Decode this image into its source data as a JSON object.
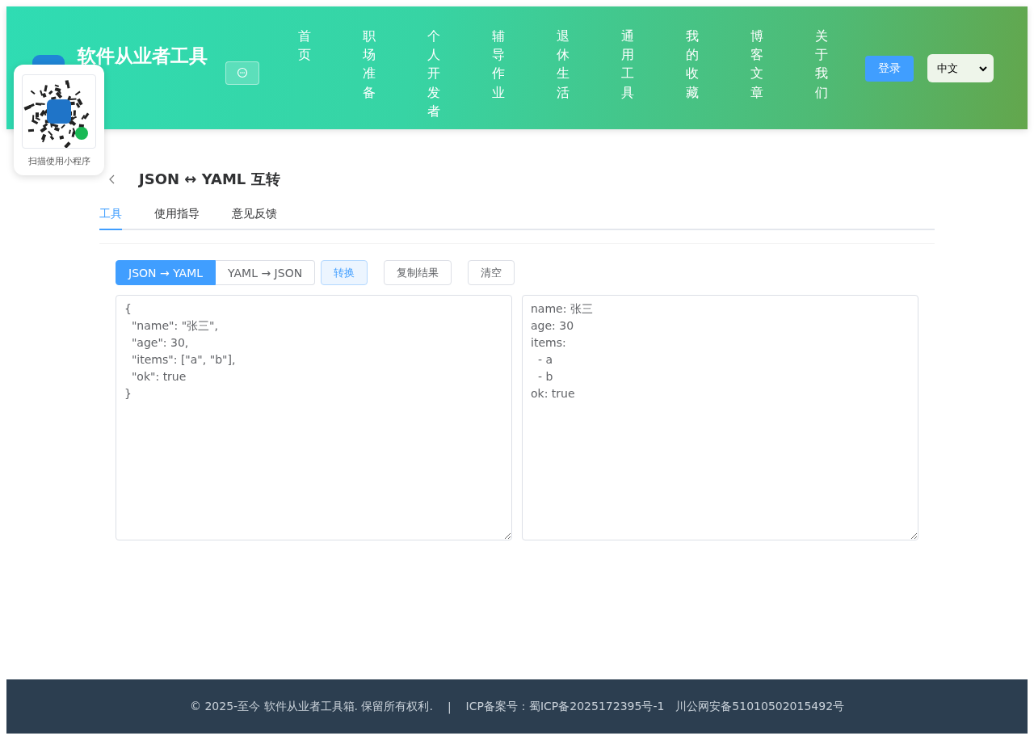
{
  "header": {
    "title": "软件从业者工具",
    "nav": [
      {
        "label": "首页"
      },
      {
        "label": "职场准备"
      },
      {
        "label": "个人开发者"
      },
      {
        "label": "辅导作业"
      },
      {
        "label": "退休生活"
      },
      {
        "label": "通用工具"
      },
      {
        "label": "我的收藏"
      },
      {
        "label": "博客文章"
      },
      {
        "label": "关于我们"
      }
    ],
    "login": "登录",
    "language": "中文"
  },
  "qr_popup": {
    "caption": "扫描使用小程序"
  },
  "page": {
    "title": "JSON ↔ YAML 互转",
    "tabs": [
      {
        "label": "工具",
        "selected": true
      },
      {
        "label": "使用指导",
        "selected": false
      },
      {
        "label": "意见反馈",
        "selected": false
      }
    ],
    "modes": [
      {
        "label": "JSON → YAML",
        "selected": true
      },
      {
        "label": "YAML → JSON",
        "selected": false
      }
    ],
    "actions": [
      {
        "label": "转换",
        "kind": "primary"
      },
      {
        "label": "复制结果",
        "kind": "plain"
      },
      {
        "label": "清空",
        "kind": "plain"
      }
    ],
    "input": {
      "value": "{\n  \"name\": \"张三\",\n  \"age\": 30,\n  \"items\": [\"a\", \"b\"],\n  \"ok\": true\n}"
    },
    "output": {
      "value": "name: 张三\nage: 30\nitems:\n  - a\n  - b\nok: true"
    }
  },
  "footer": {
    "copyright": "© 2025-至今 软件从业者工具箱. 保留所有权利.",
    "separator": "|",
    "icp": "ICP备案号：蜀ICP备2025172395号-1",
    "police": "川公网安备51010502015492号"
  }
}
